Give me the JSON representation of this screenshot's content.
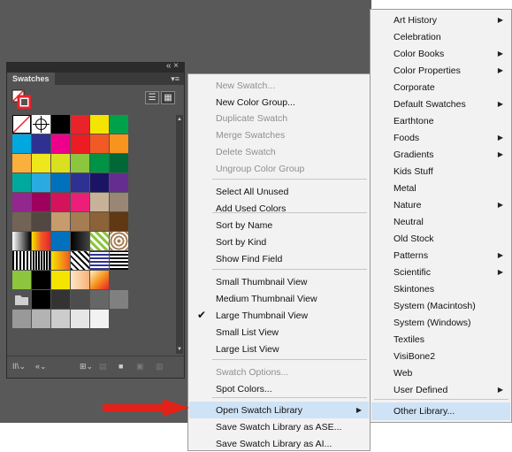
{
  "panel": {
    "tab_label": "Swatches",
    "window_buttons": "« ×",
    "menu_icon": "▾≡"
  },
  "swatches": {
    "colors": [
      [
        "none",
        "registration",
        "#000000",
        "#e8232a",
        "#f5e400",
        "#00a14b"
      ],
      [
        "#00a7e1",
        "#2e3192",
        "#ec008c",
        "#ed1c24",
        "#f15a24",
        "#f7941d"
      ],
      [
        "#fbb03b",
        "#ede71b",
        "#d9e021",
        "#8cc63f",
        "#009245",
        "#006837"
      ],
      [
        "#00a99d",
        "#29abe2",
        "#0071bc",
        "#2e3192",
        "#1b1464",
        "#662d91"
      ],
      [
        "#93278f",
        "#9e005d",
        "#d4145a",
        "#ed1e79",
        "#c7b299",
        "#998675"
      ],
      [
        "#736357",
        "#534741",
        "#c69c6d",
        "#a67c52",
        "#8c6239",
        "#603813"
      ],
      [
        "gradient-bw",
        "gradient-rainbow",
        "#0071bc",
        "gradient-black",
        "pattern-leaf",
        "pattern-swirl"
      ],
      [
        "pattern-stripes",
        "pattern-stripes2",
        "gradient-orange",
        "pattern-diag",
        "pattern-blue",
        "pattern-grid"
      ],
      [
        "#8cc63f",
        "#000000",
        "#f5e400",
        "gradient-peach",
        "gradient-sunset",
        ""
      ],
      [
        "folder",
        "#000000",
        "#333333",
        "#4d4d4d",
        "#666666",
        "#808080"
      ],
      [
        "#999999",
        "#b3b3b3",
        "#cccccc",
        "#e6e6e6",
        "#f2f2f2",
        ""
      ]
    ]
  },
  "flyout": {
    "items": [
      {
        "label": "New Swatch...",
        "disabled": true
      },
      {
        "label": "New Color Group...",
        "disabled": false
      },
      {
        "label": "Duplicate Swatch",
        "disabled": true
      },
      {
        "label": "Merge Swatches",
        "disabled": true
      },
      {
        "label": "Delete Swatch",
        "disabled": true
      },
      {
        "label": "Ungroup Color Group",
        "disabled": true
      },
      {
        "label": "Select All Unused",
        "disabled": false
      },
      {
        "label": "Add Used Colors",
        "disabled": false
      },
      {
        "label": "Sort by Name",
        "disabled": false
      },
      {
        "label": "Sort by Kind",
        "disabled": false
      },
      {
        "label": "Show Find Field",
        "disabled": false
      },
      {
        "label": "Small Thumbnail View",
        "disabled": false
      },
      {
        "label": "Medium Thumbnail View",
        "disabled": false
      },
      {
        "label": "Large Thumbnail View",
        "disabled": false,
        "checked": true
      },
      {
        "label": "Small List View",
        "disabled": false
      },
      {
        "label": "Large List View",
        "disabled": false
      },
      {
        "label": "Swatch Options...",
        "disabled": true
      },
      {
        "label": "Spot Colors...",
        "disabled": false
      },
      {
        "label": "Open Swatch Library",
        "disabled": false,
        "highlighted": true
      },
      {
        "label": "Save Swatch Library as ASE...",
        "disabled": false
      },
      {
        "label": "Save Swatch Library as AI...",
        "disabled": false
      }
    ],
    "check_mark": "✔",
    "submenu_arrow": "▶"
  },
  "library": {
    "items": [
      {
        "label": "Art History",
        "arrow": true
      },
      {
        "label": "Celebration",
        "arrow": false
      },
      {
        "label": "Color Books",
        "arrow": true
      },
      {
        "label": "Color Properties",
        "arrow": true
      },
      {
        "label": "Corporate",
        "arrow": false
      },
      {
        "label": "Default Swatches",
        "arrow": true
      },
      {
        "label": "Earthtone",
        "arrow": false
      },
      {
        "label": "Foods",
        "arrow": true
      },
      {
        "label": "Gradients",
        "arrow": true
      },
      {
        "label": "Kids Stuff",
        "arrow": false
      },
      {
        "label": "Metal",
        "arrow": false
      },
      {
        "label": "Nature",
        "arrow": true
      },
      {
        "label": "Neutral",
        "arrow": false
      },
      {
        "label": "Old Stock",
        "arrow": false
      },
      {
        "label": "Patterns",
        "arrow": true
      },
      {
        "label": "Scientific",
        "arrow": true
      },
      {
        "label": "Skintones",
        "arrow": false
      },
      {
        "label": "System (Macintosh)",
        "arrow": false
      },
      {
        "label": "System (Windows)",
        "arrow": false
      },
      {
        "label": "Textiles",
        "arrow": false
      },
      {
        "label": "VisiBone2",
        "arrow": false
      },
      {
        "label": "Web",
        "arrow": false
      },
      {
        "label": "User Defined",
        "arrow": true
      },
      {
        "label": "Other Library...",
        "arrow": false,
        "highlighted": true
      }
    ]
  },
  "annotation": {
    "arrow_color": "#e32119"
  }
}
